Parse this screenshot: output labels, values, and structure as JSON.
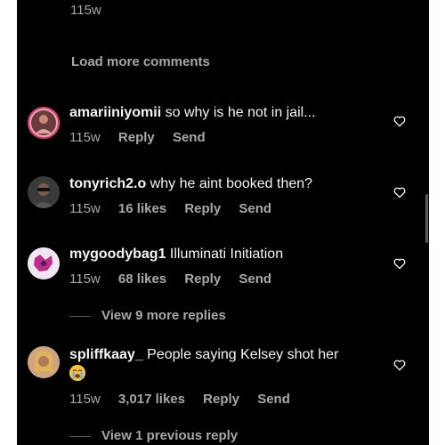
{
  "top": {
    "timestamp": "115w"
  },
  "load_more_label": "Load more comments",
  "comments": [
    {
      "username": "amariiniyomii",
      "text": " so why is he not in jail...",
      "time": "115w",
      "likes": "",
      "reply": "Reply",
      "send": "Send"
    },
    {
      "username": "tonyrich2.o",
      "text": " why he aint booked then?",
      "time": "115w",
      "likes": "16 likes",
      "reply": "Reply",
      "send": "Send"
    },
    {
      "username": "mygoodybag1",
      "text": " Illuminati Initiation",
      "time": "115w",
      "likes": "68 likes",
      "reply": "Reply",
      "send": "Send",
      "view_replies": "View 9 more replies"
    },
    {
      "username": "spliffkaay_",
      "text": " People saying Kelsey shot her",
      "emoji": "😭",
      "time": "115w",
      "likes": "3,017 likes",
      "reply": "Reply",
      "send": "Send",
      "view_replies": "View 1 previous reply"
    }
  ],
  "icons": {
    "like": "heart-outline-icon",
    "emoji": "loudly-crying-face-icon"
  },
  "colors": {
    "background": "#000000",
    "text": "#f5f5f5",
    "muted": "#a8a8a8"
  }
}
